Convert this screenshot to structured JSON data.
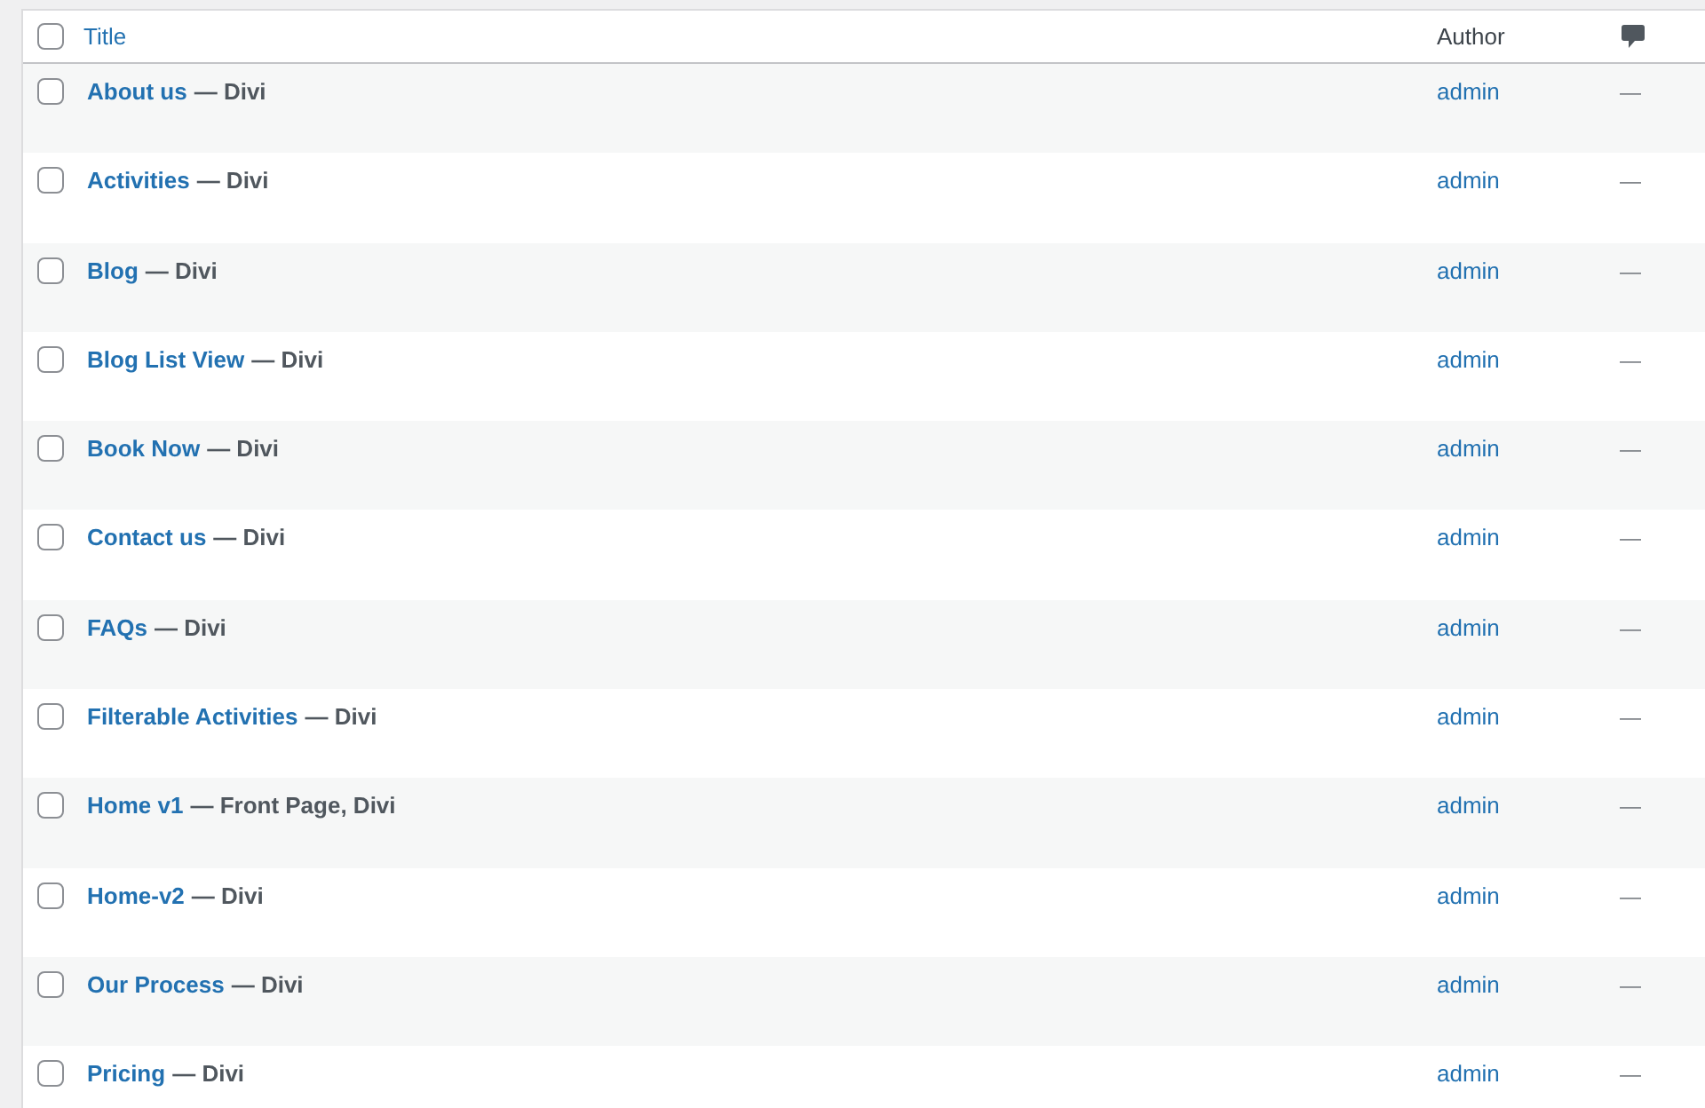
{
  "table": {
    "select_all_checked": false,
    "columns": {
      "title": "Title",
      "author": "Author"
    },
    "rows": [
      {
        "title": "About us",
        "post_state": "— Divi",
        "author": "admin",
        "comments": "—",
        "checked": false
      },
      {
        "title": "Activities",
        "post_state": "— Divi",
        "author": "admin",
        "comments": "—",
        "checked": false
      },
      {
        "title": "Blog",
        "post_state": "— Divi",
        "author": "admin",
        "comments": "—",
        "checked": false
      },
      {
        "title": "Blog List View",
        "post_state": "— Divi",
        "author": "admin",
        "comments": "—",
        "checked": false
      },
      {
        "title": "Book Now",
        "post_state": "— Divi",
        "author": "admin",
        "comments": "—",
        "checked": false
      },
      {
        "title": "Contact us",
        "post_state": "— Divi",
        "author": "admin",
        "comments": "—",
        "checked": false
      },
      {
        "title": "FAQs",
        "post_state": "— Divi",
        "author": "admin",
        "comments": "—",
        "checked": false
      },
      {
        "title": "Filterable Activities",
        "post_state": "— Divi",
        "author": "admin",
        "comments": "—",
        "checked": false
      },
      {
        "title": "Home v1",
        "post_state": "— Front Page, Divi",
        "author": "admin",
        "comments": "—",
        "checked": false
      },
      {
        "title": "Home-v2",
        "post_state": "— Divi",
        "author": "admin",
        "comments": "—",
        "checked": false
      },
      {
        "title": "Our Process",
        "post_state": "— Divi",
        "author": "admin",
        "comments": "—",
        "checked": false
      },
      {
        "title": "Pricing",
        "post_state": "— Divi",
        "author": "admin",
        "comments": "—",
        "checked": false
      }
    ]
  }
}
